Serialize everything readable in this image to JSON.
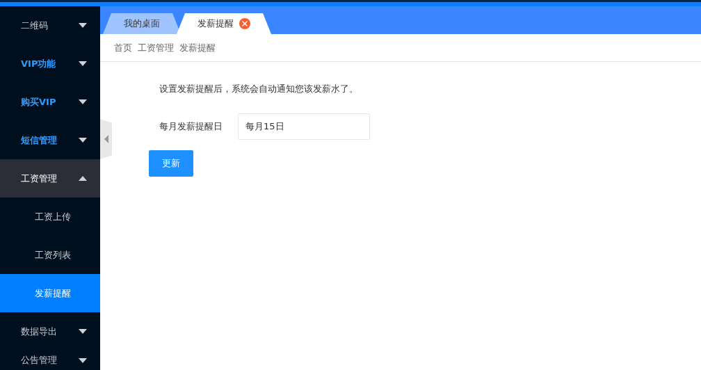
{
  "sidebar": {
    "items": [
      {
        "label": "二维码",
        "expanded": false
      },
      {
        "label": "VIP功能",
        "color": "#2f9bff",
        "expanded": false
      },
      {
        "label": "购买VIP",
        "color": "#2f9bff",
        "expanded": false
      },
      {
        "label": "短信管理",
        "color": "#2f9bff",
        "expanded": false
      },
      {
        "label": "工资管理",
        "color": "#ffffff",
        "expanded": true,
        "children": [
          {
            "label": "工资上传",
            "selected": false
          },
          {
            "label": "工资列表",
            "selected": false
          },
          {
            "label": "发薪提醒",
            "selected": true
          }
        ]
      },
      {
        "label": "数据导出",
        "expanded": false
      },
      {
        "label": "公告管理",
        "expanded": false
      }
    ]
  },
  "tabs": [
    {
      "label": "我的桌面",
      "selected": false,
      "closable": false
    },
    {
      "label": "发薪提醒",
      "selected": true,
      "closable": true
    }
  ],
  "breadcrumb": [
    "首页",
    "工资管理",
    "发薪提醒"
  ],
  "form": {
    "notice": "设置发薪提醒后，系统会自动通知您该发薪水了。",
    "field_label": "每月发薪提醒日",
    "field_value": "每月15日",
    "button": "更新"
  }
}
